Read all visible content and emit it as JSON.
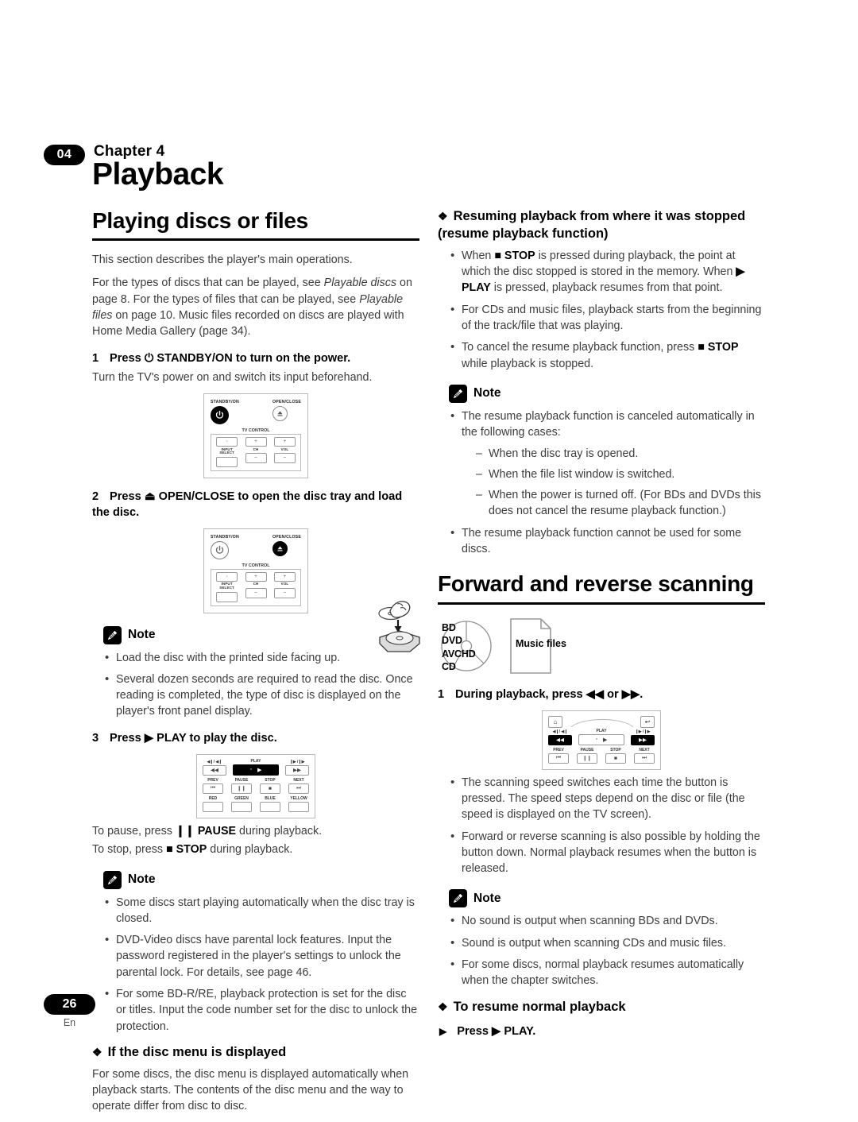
{
  "header": {
    "chapter_number": "04",
    "chapter_label": "Chapter 4",
    "chapter_title": "Playback"
  },
  "footer": {
    "page_number": "26",
    "language": "En"
  },
  "left_column": {
    "section_title": "Playing discs or files",
    "intro_1": "This section describes the player's main operations.",
    "intro_2_a": "For the types of discs that can be played, see ",
    "intro_2_i1": "Playable discs",
    "intro_2_b": " on page 8. For the types of files that can be played, see ",
    "intro_2_i2": "Playable files",
    "intro_2_c": " on page 10. Music files recorded on discs are played with Home Media Gallery (page 34).",
    "step1_num": "1",
    "step1_text": "Press ⏻ STANDBY/ON to turn on the power.",
    "step1_body": "Turn the TV's power on and switch its input beforehand.",
    "step2_num": "2",
    "step2_text": "Press ⏏ OPEN/CLOSE to open the disc tray and load the disc.",
    "note1_label": "Note",
    "note1_items": [
      "Load the disc with the printed side facing up.",
      "Several dozen seconds are required to read the disc. Once reading is completed, the type of disc is displayed on the player's front panel display."
    ],
    "step3_num": "3",
    "step3_text": "Press ▶ PLAY to play the disc.",
    "pause_line_a": "To pause, press ",
    "pause_line_key": "❙❙ PAUSE",
    "pause_line_b": " during playback.",
    "stop_line_a": "To stop, press ",
    "stop_line_key": "■ STOP",
    "stop_line_b": " during playback.",
    "note2_label": "Note",
    "note2_items": [
      "Some discs start playing automatically when the disc tray is closed.",
      "DVD-Video discs have parental lock features. Input the password registered in the player's settings to unlock the parental lock. For details, see page 46.",
      "For some BD-R/RE, playback protection is set for the disc or titles. Input the code number set for the disc to unlock the protection."
    ],
    "subheading_disc_menu": "If the disc menu is displayed",
    "disc_menu_body": "For some discs, the disc menu is displayed automatically when playback starts. The contents of the disc menu and the way to operate differ from disc to disc."
  },
  "right_column": {
    "subheading_resume": "Resuming playback from where it was stopped (resume playback function)",
    "resume_items": [
      {
        "a": "When ",
        "k1": "■ STOP",
        "b": " is pressed during playback, the point at which the disc stopped is stored in the memory. When ",
        "k2": "▶ PLAY",
        "c": " is pressed, playback resumes from that point."
      },
      {
        "a": "For CDs and music files, playback starts from the beginning of the track/file that was playing.",
        "k1": "",
        "b": "",
        "k2": "",
        "c": ""
      },
      {
        "a": "To cancel the resume playback function, press ",
        "k1": "■ STOP",
        "b": " while playback is stopped.",
        "k2": "",
        "c": ""
      }
    ],
    "note1_label": "Note",
    "note1_lead": "The resume playback function is canceled automatically in the following cases:",
    "note1_dashes": [
      "When the disc tray is opened.",
      "When the file list window is switched.",
      "When the power is turned off. (For BDs and DVDs this does not cancel the resume playback function.)"
    ],
    "note1_last": "The resume playback function cannot be used for some discs.",
    "section_title": "Forward and reverse scanning",
    "media_disc_lines": [
      "BD",
      "DVD",
      "AVCHD",
      "CD"
    ],
    "media_file_label": "Music files",
    "scan_step_num": "1",
    "scan_step_text": "During playback, press ◀◀ or ▶▶.",
    "scan_items": [
      "The scanning speed switches each time the button is pressed. The speed steps depend on the disc or file (the speed is displayed on the TV screen).",
      "Forward or reverse scanning is also possible by holding the button down. Normal playback resumes when the button is released."
    ],
    "note2_label": "Note",
    "note2_items": [
      "No sound is output when scanning BDs and DVDs.",
      "Sound is output when scanning CDs and music files.",
      "For some discs, normal playback resumes automatically when the chapter switches."
    ],
    "subheading_resume_normal": "To resume normal playback",
    "resume_normal_step": "Press ▶ PLAY."
  },
  "remote_standby": {
    "label_standby": "STANDBY/ON",
    "label_openclose": "OPEN/CLOSE",
    "label_tvcontrol": "TV CONTROL",
    "label_input_select": "INPUT SELECT",
    "label_ch": "CH",
    "label_vol": "VOL",
    "plus": "+",
    "minus": "–"
  },
  "remote_play": {
    "label_play": "PLAY",
    "label_rev_top": "◀❙/ ◀❙",
    "label_fwd_top": "❙▶ /❙▶",
    "label_prev": "PREV",
    "label_pause": "PAUSE",
    "label_stop": "STOP",
    "label_next": "NEXT",
    "label_red": "RED",
    "label_green": "GREEN",
    "label_blue": "BLUE",
    "label_yellow": "YELLOW"
  },
  "symbols": {
    "diamond": "❖",
    "triangle": "▶",
    "power": "⏻",
    "eject": "⏏",
    "rev": "◀◀",
    "fwd": "▶▶",
    "prev": "⏮",
    "next": "⏭",
    "pause": "❙❙",
    "stop": "■",
    "play": "▶",
    "home": "⌂",
    "return": "↩",
    "dot": "◦"
  },
  "colors": {
    "ink": "#000000",
    "body_text": "#3d3d3d",
    "rule": "#000000",
    "diagram_line": "#b9b9b9"
  }
}
